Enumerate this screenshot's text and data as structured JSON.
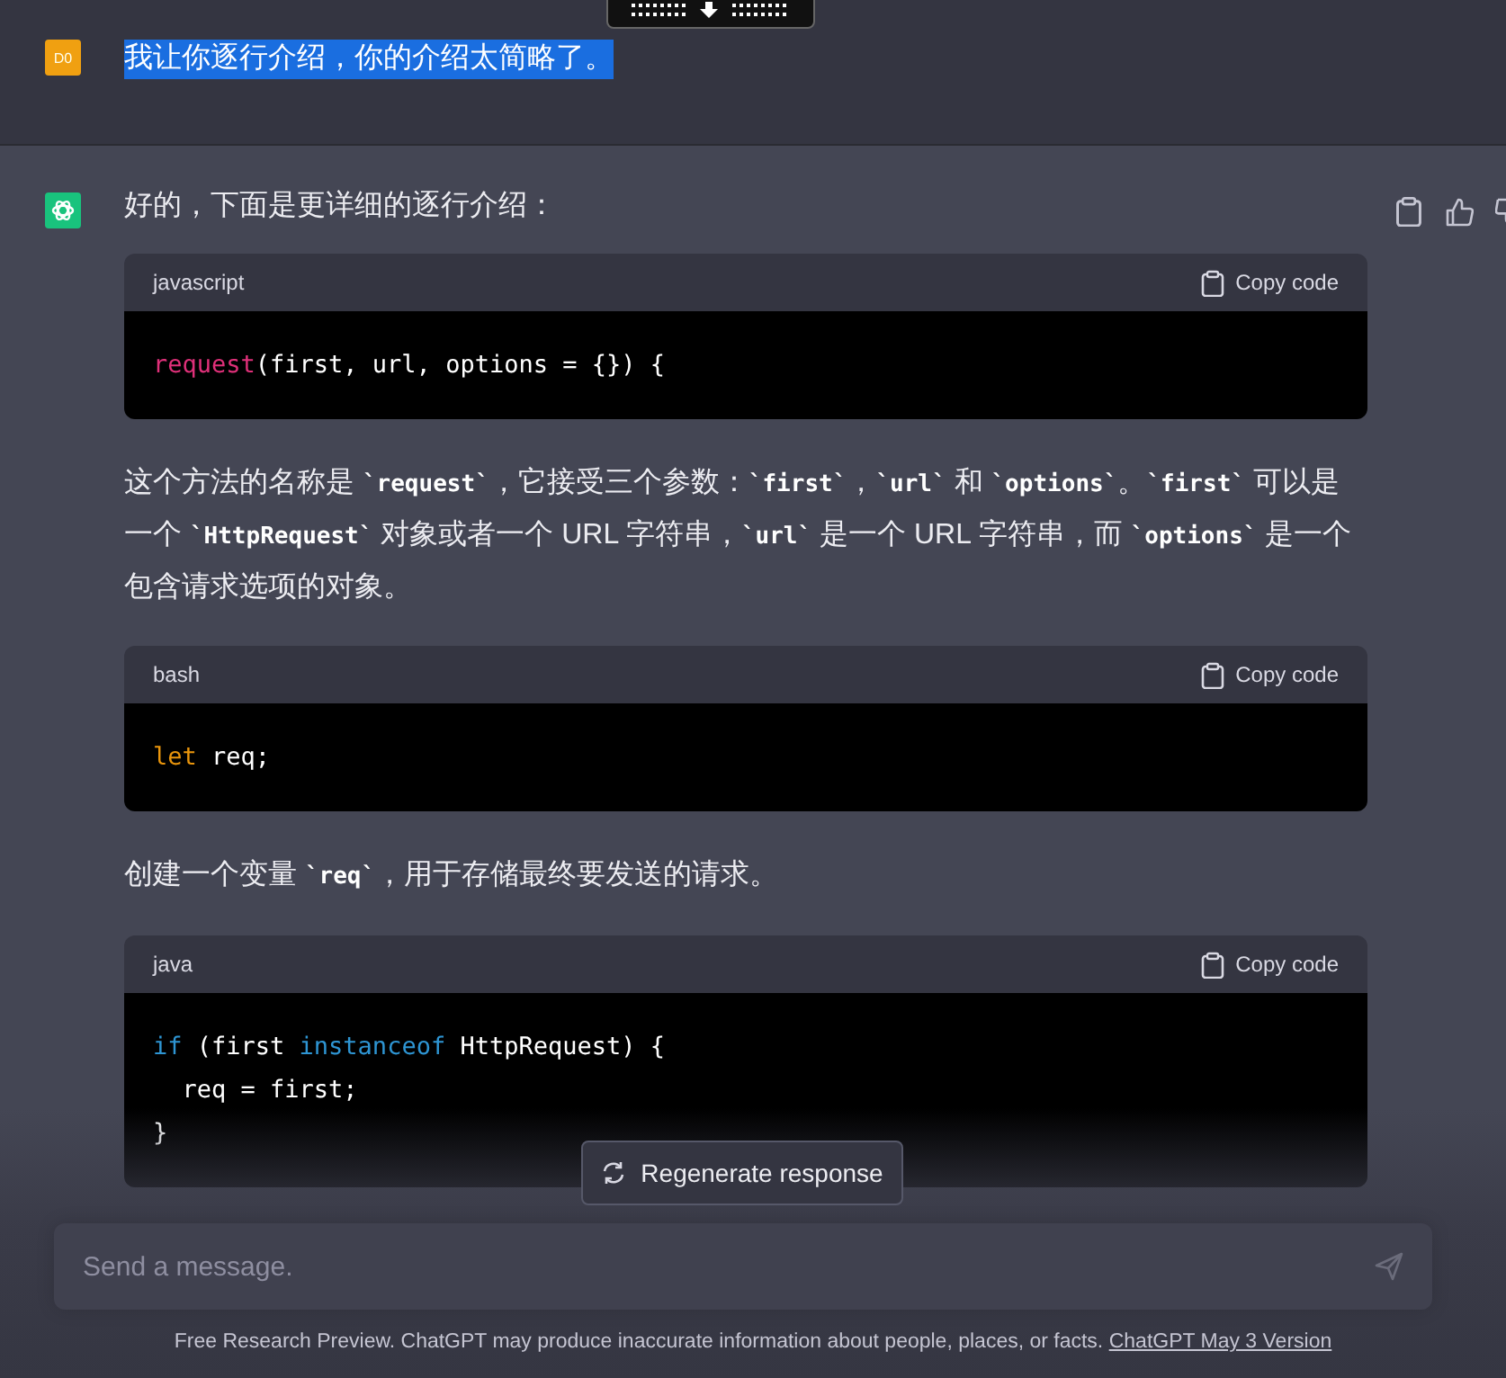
{
  "user_message": {
    "avatar": "D0",
    "text": "我让你逐行介绍，你的介绍太简略了。",
    "selected": true
  },
  "assistant_message": {
    "blocks": [
      {
        "kind": "paragraph",
        "segments": [
          {
            "kind": "text",
            "text": "好的，下面是更详细的逐行介绍："
          }
        ]
      },
      {
        "kind": "code",
        "language": "javascript",
        "copy_label": "Copy code",
        "lines": [
          [
            {
              "kind": "function",
              "text": "request"
            },
            {
              "kind": "plain",
              "text": "(first, url, options = {}) {"
            }
          ]
        ]
      },
      {
        "kind": "paragraph",
        "segments": [
          {
            "kind": "text",
            "text": "这个方法的名称是 "
          },
          {
            "kind": "code",
            "text": "`request`"
          },
          {
            "kind": "text",
            "text": "，它接受三个参数："
          },
          {
            "kind": "code",
            "text": "`first`"
          },
          {
            "kind": "text",
            "text": "，"
          },
          {
            "kind": "code",
            "text": "`url`"
          },
          {
            "kind": "text",
            "text": " 和 "
          },
          {
            "kind": "code",
            "text": "`options`"
          },
          {
            "kind": "text",
            "text": "。"
          },
          {
            "kind": "code",
            "text": "`first`"
          },
          {
            "kind": "text",
            "text": " 可以是一个 "
          },
          {
            "kind": "code",
            "text": "`HttpRequest`"
          },
          {
            "kind": "text",
            "text": " 对象或者一个 URL 字符串，"
          },
          {
            "kind": "code",
            "text": "`url`"
          },
          {
            "kind": "text",
            "text": " 是一个 URL 字符串，而 "
          },
          {
            "kind": "code",
            "text": "`options`"
          },
          {
            "kind": "text",
            "text": " 是一个包含请求选项的对象。"
          }
        ]
      },
      {
        "kind": "code",
        "language": "bash",
        "copy_label": "Copy code",
        "lines": [
          [
            {
              "kind": "declare",
              "text": "let"
            },
            {
              "kind": "plain",
              "text": " req;"
            }
          ]
        ]
      },
      {
        "kind": "paragraph",
        "segments": [
          {
            "kind": "text",
            "text": "创建一个变量 "
          },
          {
            "kind": "code",
            "text": "`req`"
          },
          {
            "kind": "text",
            "text": "，用于存储最终要发送的请求。"
          }
        ]
      },
      {
        "kind": "code",
        "language": "java",
        "copy_label": "Copy code",
        "lines": [
          [
            {
              "kind": "keyword",
              "text": "if"
            },
            {
              "kind": "plain",
              "text": " (first "
            },
            {
              "kind": "keyword",
              "text": "instanceof"
            },
            {
              "kind": "plain",
              "text": " HttpRequest) {"
            }
          ],
          [
            {
              "kind": "plain",
              "text": "  req = first;"
            }
          ],
          [
            {
              "kind": "plain",
              "text": "}"
            }
          ]
        ]
      }
    ]
  },
  "regenerate_button": "Regenerate response",
  "composer": {
    "placeholder": "Send a message."
  },
  "footer": {
    "text": "Free Research Preview. ChatGPT may produce inaccurate information about people, places, or facts.",
    "link": "ChatGPT May 3 Version"
  }
}
